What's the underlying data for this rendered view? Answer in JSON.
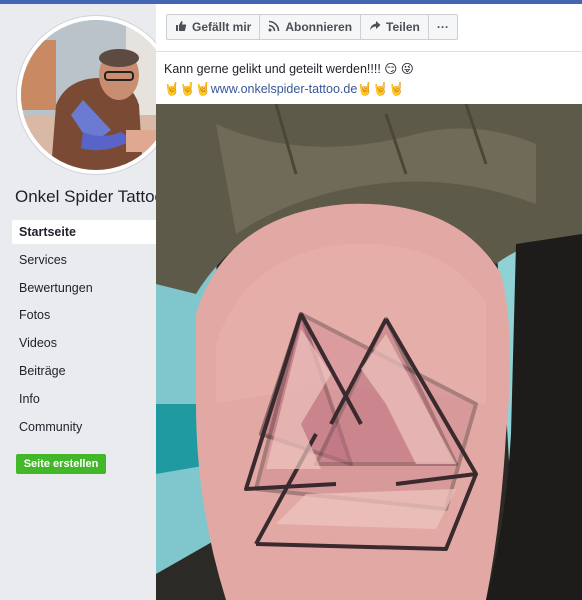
{
  "page": {
    "name": "Onkel Spider Tattoo"
  },
  "nav": {
    "items": [
      {
        "label": "Startseite",
        "active": true
      },
      {
        "label": "Services"
      },
      {
        "label": "Bewertungen"
      },
      {
        "label": "Fotos"
      },
      {
        "label": "Videos"
      },
      {
        "label": "Beiträge"
      },
      {
        "label": "Info"
      },
      {
        "label": "Community"
      }
    ],
    "create_button": "Seite erstellen"
  },
  "actions": {
    "like": "Gefällt mir",
    "subscribe": "Abonnieren",
    "share": "Teilen",
    "more": "···"
  },
  "post": {
    "text": "Kann gerne gelikt und geteilt werden!!!! 😏 😜",
    "link_prefix": "🤘🤘🤘",
    "link_text": "www.onkelspider-tattoo.de",
    "link_suffix": "🤘🤘🤘"
  },
  "colors": {
    "accent": "#4267b2",
    "create_button": "#42b72a",
    "link": "#385898"
  }
}
